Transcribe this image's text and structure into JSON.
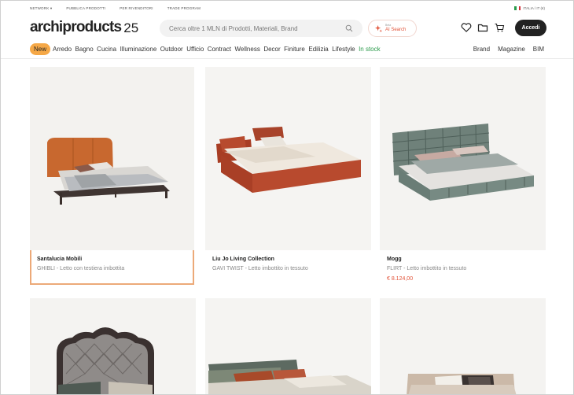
{
  "topbar": {
    "links": [
      "NETWORK",
      "PUBBLICA PRODOTTI",
      "PER RIVENDITORI",
      "TRADE PROGRAM"
    ],
    "locale": "ITALIA / IT (€)"
  },
  "header": {
    "logo": "archiproducts",
    "logo_badge": "25",
    "search_placeholder": "Cerca oltre 1 MLN di Prodotti, Materiali, Brand",
    "ai_beta": "Beta",
    "ai_label": "AI Search",
    "login_label": "Accedi"
  },
  "nav": {
    "new_label": "New",
    "items": [
      "Arredo",
      "Bagno",
      "Cucina",
      "Illuminazione",
      "Outdoor",
      "Ufficio",
      "Contract",
      "Wellness",
      "Decor",
      "Finiture",
      "Edilizia",
      "Lifestyle"
    ],
    "in_stock": "In stock",
    "right": [
      "Brand",
      "Magazine",
      "BIM"
    ]
  },
  "products": [
    {
      "brand": "Santalucia Mobili",
      "desc": "GHIBLI - Letto con testiera imbottita",
      "price": ""
    },
    {
      "brand": "Liu Jo Living Collection",
      "desc": "GAVI TWIST - Letto imbottito in tessuto",
      "price": ""
    },
    {
      "brand": "Mogg",
      "desc": "FLIRT - Letto imbottito in tessuto",
      "price": "€ 8.124,00"
    },
    {
      "brand": "",
      "desc": "",
      "price": ""
    },
    {
      "brand": "",
      "desc": "",
      "price": ""
    },
    {
      "brand": "",
      "desc": "",
      "price": ""
    }
  ],
  "colors": {
    "accent": "#e2543a",
    "new_badge": "#f5a847",
    "in_stock": "#2a9a4a",
    "selected_outline": "#eca978"
  }
}
